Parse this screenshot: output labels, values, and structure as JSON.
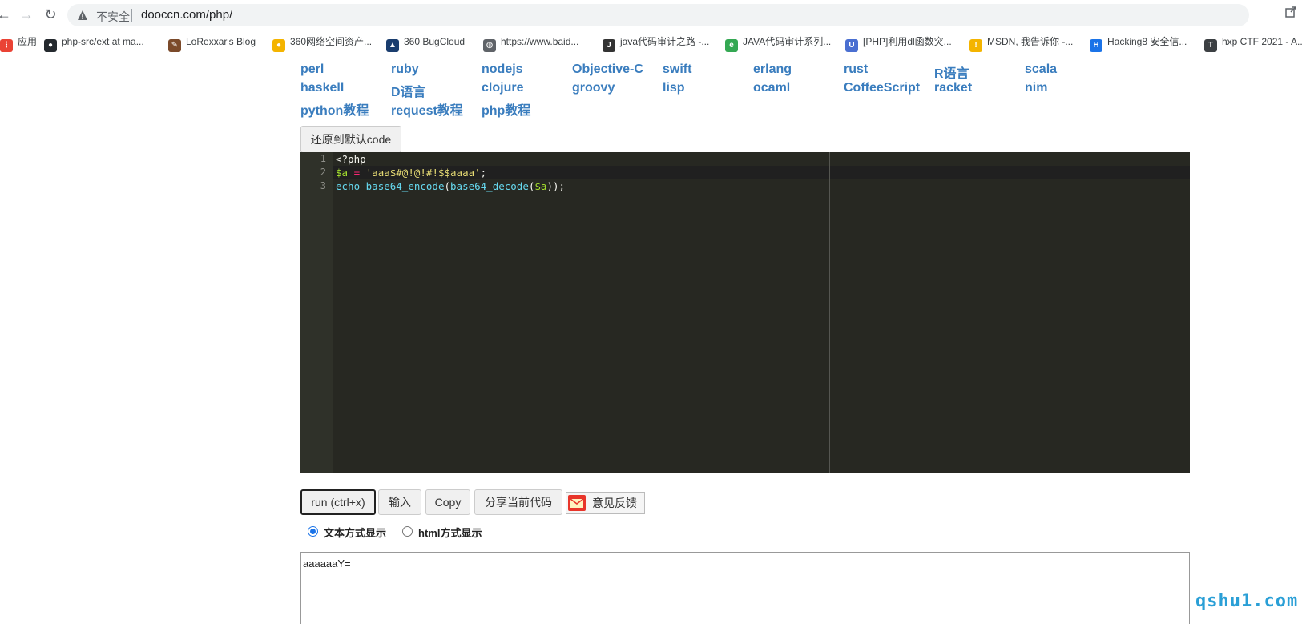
{
  "browser": {
    "insecure_label": "不安全",
    "url": "dooccn.com/php/",
    "bookmarks": [
      {
        "label": "应用",
        "icon": "apps-icon"
      },
      {
        "label": "php-src/ext at ma...",
        "icon": "github-icon"
      },
      {
        "label": "LoRexxar's Blog",
        "icon": "blog-icon"
      },
      {
        "label": "360网络空间资产...",
        "icon": "360-icon"
      },
      {
        "label": "360 BugCloud",
        "icon": "bugcloud-icon"
      },
      {
        "label": "https://www.baid...",
        "icon": "globe-icon"
      },
      {
        "label": "java代码审计之路 -...",
        "icon": "java-icon"
      },
      {
        "label": "JAVA代码审计系列...",
        "icon": "e-icon"
      },
      {
        "label": "[PHP]利用dl函数突...",
        "icon": "shield-icon"
      },
      {
        "label": "MSDN, 我告诉你 -...",
        "icon": "msdn-icon"
      },
      {
        "label": "Hacking8 安全信...",
        "icon": "hacking8-icon"
      },
      {
        "label": "hxp CTF 2021 - A...",
        "icon": "hxp-icon"
      }
    ]
  },
  "languages": [
    [
      "perl",
      "ruby",
      "nodejs",
      "Objective-C",
      "swift",
      "erlang",
      "rust",
      "R语言",
      "scala"
    ],
    [
      "haskell",
      "D语言",
      "clojure",
      "groovy",
      "lisp",
      "ocaml",
      "CoffeeScript",
      "racket",
      "nim"
    ],
    [
      "python教程",
      "request教程",
      "php教程"
    ]
  ],
  "restore_button": "还原到默认code",
  "editor": {
    "line_numbers": [
      "1",
      "2",
      "3"
    ],
    "lines": [
      [
        {
          "t": "plain",
          "v": "<?php"
        }
      ],
      [
        {
          "t": "var",
          "v": "$a"
        },
        {
          "t": "plain",
          "v": " "
        },
        {
          "t": "op",
          "v": "="
        },
        {
          "t": "plain",
          "v": " "
        },
        {
          "t": "str",
          "v": "'aaa$#@!@!#!$$aaaa'"
        },
        {
          "t": "plain",
          "v": ";"
        }
      ],
      [
        {
          "t": "fn",
          "v": "echo"
        },
        {
          "t": "plain",
          "v": " "
        },
        {
          "t": "fn",
          "v": "base64_encode"
        },
        {
          "t": "plain",
          "v": "("
        },
        {
          "t": "fn",
          "v": "base64_decode"
        },
        {
          "t": "plain",
          "v": "("
        },
        {
          "t": "var",
          "v": "$a"
        },
        {
          "t": "plain",
          "v": "));"
        }
      ]
    ]
  },
  "toolbar": {
    "run": "run (ctrl+x)",
    "input": "输入",
    "copy": "Copy",
    "share": "分享当前代码",
    "feedback": "意见反馈"
  },
  "display_mode": {
    "text": "文本方式显示",
    "html": "html方式显示",
    "selected": "text"
  },
  "output": "aaaaaaY=",
  "watermark": "qshu1.com",
  "colors": {
    "link": "#3a7dbe",
    "editor_bg": "#272822",
    "watermark": "#2a9fd6"
  }
}
